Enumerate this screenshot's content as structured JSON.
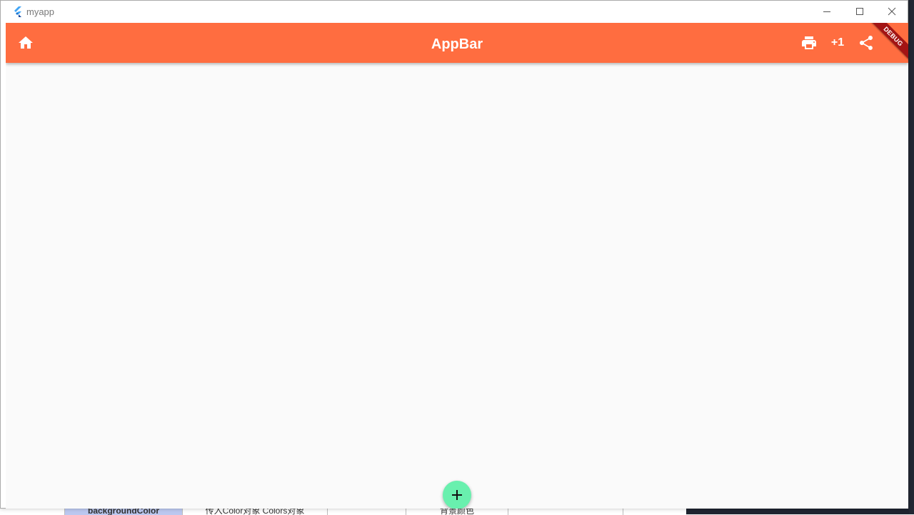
{
  "window": {
    "title": "myapp",
    "controls": {
      "minimize": "minimize",
      "maximize": "maximize",
      "close": "close"
    }
  },
  "appbar": {
    "title": "AppBar",
    "leading_icon": "home-icon",
    "actions": [
      {
        "name": "print",
        "icon": "print-icon"
      },
      {
        "name": "plus-one",
        "label": "+1"
      },
      {
        "name": "share",
        "icon": "share-icon"
      }
    ],
    "color": "#ff6d40"
  },
  "debug_banner": {
    "label": "DEBUG",
    "color": "#a31414"
  },
  "fab": {
    "icon": "add-icon",
    "color": "#69f0ae"
  },
  "background_table": {
    "cells": [
      "backgroundColor",
      "传入Color对象 Colors对象",
      "",
      "背景颜色",
      ""
    ]
  }
}
